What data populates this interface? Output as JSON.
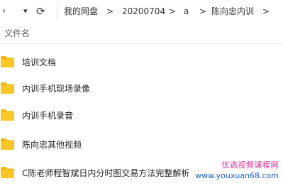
{
  "nav": {
    "dropdown_glyph": "▾",
    "refresh_glyph": "⟳",
    "sep": ">",
    "breadcrumb": [
      "我的网盘",
      "20200704",
      "a",
      "陈向忠内训"
    ]
  },
  "list": {
    "column_header": "文件名",
    "items": [
      {
        "name": "培训文档",
        "icon": "folder-icon"
      },
      {
        "name": "内训手机现场录像",
        "icon": "folder-icon"
      },
      {
        "name": "内训手机录音",
        "icon": "folder-icon"
      },
      {
        "name": "陈向忠其他视频",
        "icon": "folder-icon"
      },
      {
        "name": "C陈老师程智斌日内分时图交易方法完整解析",
        "icon": "folder-icon"
      }
    ]
  },
  "watermark": {
    "line1": "优选视频课程网",
    "line2": "www.youxuan68.com"
  },
  "colors": {
    "folder": "#f9c623",
    "folder_tab": "#f0b90b",
    "watermark_pink": "#e52a9b",
    "watermark_blue": "#1e5fd6"
  }
}
